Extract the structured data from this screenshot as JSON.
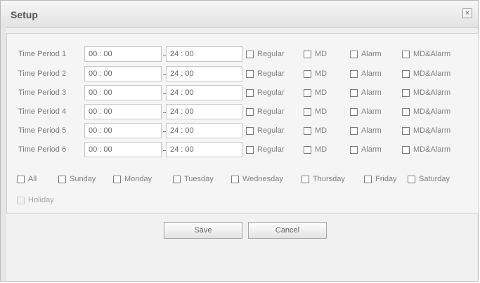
{
  "dialog": {
    "title": "Setup",
    "close_glyph": "×"
  },
  "periods": [
    {
      "label": "Time Period 1",
      "start": "00 : 00",
      "end": "24 : 00"
    },
    {
      "label": "Time Period 2",
      "start": "00 : 00",
      "end": "24 : 00"
    },
    {
      "label": "Time Period 3",
      "start": "00 : 00",
      "end": "24 : 00"
    },
    {
      "label": "Time Period 4",
      "start": "00 : 00",
      "end": "24 : 00"
    },
    {
      "label": "Time Period 5",
      "start": "00 : 00",
      "end": "24 : 00"
    },
    {
      "label": "Time Period 6",
      "start": "00 : 00",
      "end": "24 : 00"
    }
  ],
  "record_types": [
    "Regular",
    "MD",
    "Alarm",
    "MD&Alarm"
  ],
  "days": [
    "All",
    "Sunday",
    "Monday",
    "Tuesday",
    "Wednesday",
    "Thursday",
    "Friday",
    "Saturday"
  ],
  "holiday": {
    "label": "Holiday",
    "checked": false,
    "enabled": false
  },
  "buttons": {
    "save": "Save",
    "cancel": "Cancel"
  }
}
